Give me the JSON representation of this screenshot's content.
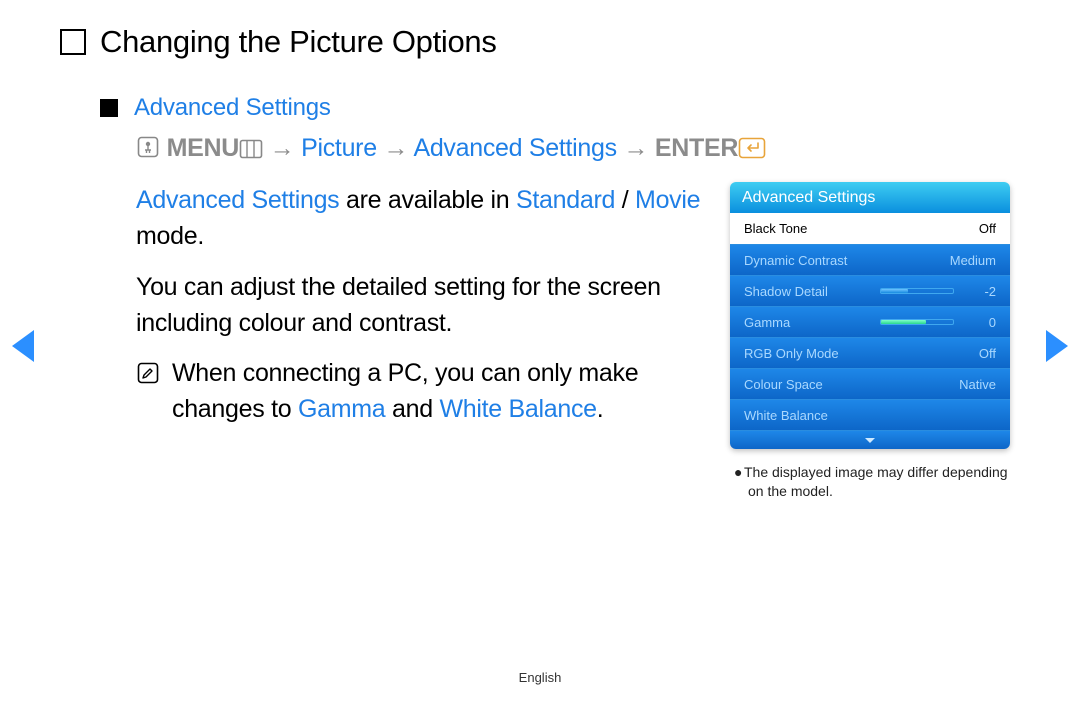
{
  "title": "Changing the Picture Options",
  "section_heading": "Advanced Settings",
  "nav_path": {
    "menu_label": "MENU",
    "step1": "Picture",
    "step2": "Advanced Settings",
    "enter_label": "ENTER",
    "arrow": "→"
  },
  "body": {
    "p1_blue1": "Advanced Settings",
    "p1_mid": " are available in ",
    "p1_blue2": "Standard",
    "p1_slash": " / ",
    "p1_blue3": "Movie",
    "p1_tail": " mode.",
    "p2": "You can adjust the detailed setting for the screen including colour and contrast.",
    "note_pre": "When connecting a PC, you can only make changes to ",
    "note_blue1": "Gamma",
    "note_and": " and ",
    "note_blue2": "White Balance",
    "note_tail": "."
  },
  "panel": {
    "header": "Advanced Settings",
    "rows": [
      {
        "label": "Black Tone",
        "value": "Off",
        "selected": true
      },
      {
        "label": "Dynamic Contrast",
        "value": "Medium"
      },
      {
        "label": "Shadow Detail",
        "value": "-2",
        "bar": {
          "color": "blue",
          "pct": 38
        }
      },
      {
        "label": "Gamma",
        "value": "0",
        "bar": {
          "color": "green",
          "pct": 62
        }
      },
      {
        "label": "RGB Only Mode",
        "value": "Off"
      },
      {
        "label": "Colour Space",
        "value": "Native"
      },
      {
        "label": "White Balance",
        "value": ""
      }
    ],
    "disclaimer": "The displayed image may differ depending on the model."
  },
  "language": "English"
}
